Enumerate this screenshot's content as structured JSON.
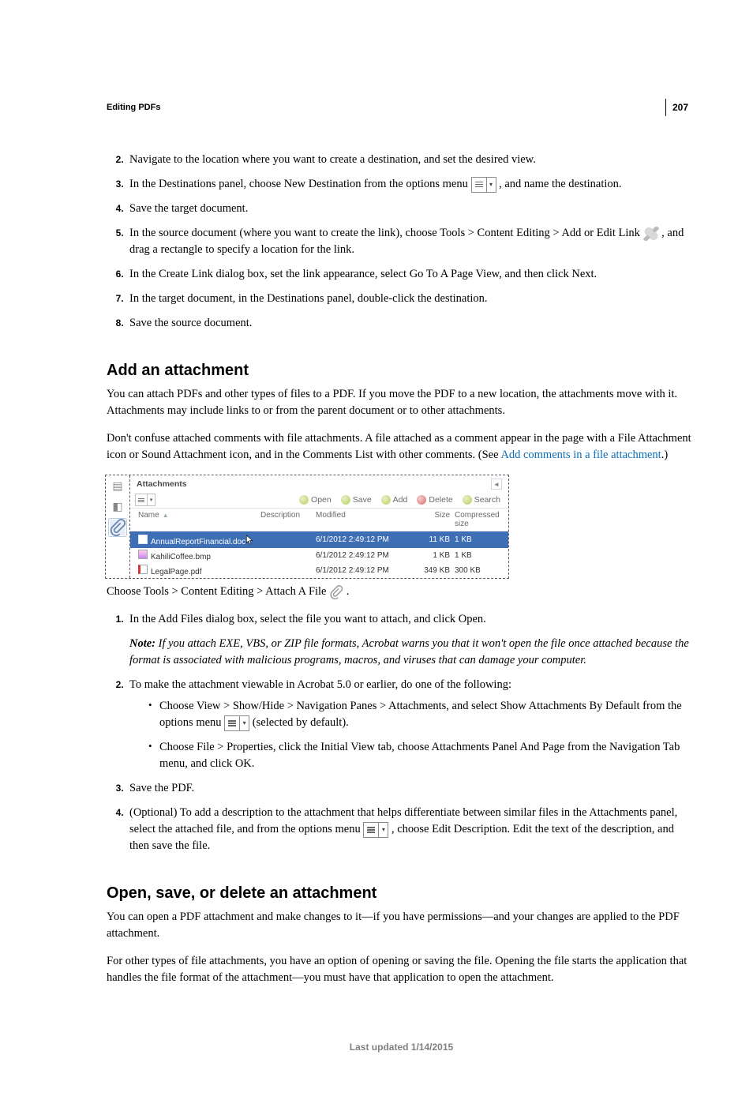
{
  "page_number": "207",
  "section_path": "Editing PDFs",
  "steps_a": {
    "s2": "Navigate to the location where you want to create a destination, and set the desired view.",
    "s3_before": "In the Destinations panel, choose New Destination from the options menu ",
    "s3_after": " , and name the destination.",
    "s4": "Save the target document.",
    "s5_before": "In the source document (where you want to create the link), choose Tools > Content Editing > Add or Edit Link ",
    "s5_after": " , and drag a rectangle to specify a location for the link.",
    "s6": "In the Create Link dialog box, set the link appearance, select Go To A Page View, and then click Next.",
    "s7": "In the target document, in the Destinations panel, double-click the destination.",
    "s8": "Save the source document."
  },
  "heading_attach": "Add an attachment",
  "para_attach_1": "You can attach PDFs and other types of files to a PDF. If you move the PDF to a new location, the attachments move with it. Attachments may include links to or from the parent document or to other attachments.",
  "para_attach_2_before": "Don't confuse attached comments with file attachments. A file attached as a comment appear in the page with a File Attachment icon or Sound Attachment icon, and in the Comments List with other comments. (See ",
  "para_attach_2_link": "Add comments in a file attachment",
  "para_attach_2_after": ".)",
  "screenshot": {
    "title": "Attachments",
    "toolbar": {
      "open": "Open",
      "save": "Save",
      "add": "Add",
      "delete": "Delete",
      "search": "Search"
    },
    "headers": {
      "name": "Name",
      "description": "Description",
      "modified": "Modified",
      "size": "Size",
      "compressed": "Compressed size"
    },
    "rows": [
      {
        "name": "AnnualReportFinancial.doc",
        "modified": "6/1/2012 2:49:12 PM",
        "size": "11 KB",
        "compressed": "1 KB"
      },
      {
        "name": "KahiliCoffee.bmp",
        "modified": "6/1/2012 2:49:12 PM",
        "size": "1 KB",
        "compressed": "1 KB"
      },
      {
        "name": "LegalPage.pdf",
        "modified": "6/1/2012 2:49:12 PM",
        "size": "349 KB",
        "compressed": "300 KB"
      }
    ]
  },
  "caption_attach_before": "Choose Tools > Content Editing > Attach A File ",
  "caption_attach_after": " .",
  "steps_b": {
    "s1": "In the Add Files dialog box, select the file you want to attach, and click Open.",
    "note_label": "Note: ",
    "note_text": "If you attach EXE, VBS, or ZIP file formats, Acrobat warns you that it won't open the file once attached because the format is associated with malicious programs, macros, and viruses that can damage your computer.",
    "s2": "To make the attachment viewable in Acrobat 5.0 or earlier, do one of the following:",
    "s2_bullets": {
      "b1_before": "Choose View > Show/Hide > Navigation Panes > Attachments, and select Show Attachments By Default from the options menu ",
      "b1_after": " (selected by default).",
      "b2": "Choose File > Properties, click the Initial View tab, choose Attachments Panel And Page from the Navigation Tab menu, and click OK."
    },
    "s3": "Save the PDF.",
    "s4_before": "(Optional) To add a description to the attachment that helps differentiate between similar files in the Attachments panel, select the attached file, and from the options menu ",
    "s4_after": " , choose Edit Description. Edit the text of the description, and then save the file."
  },
  "heading_open": "Open, save, or delete an attachment",
  "para_open_1": "You can open a PDF attachment and make changes to it—if you have permissions—and your changes are applied to the PDF attachment.",
  "para_open_2": "For other types of file attachments, you have an option of opening or saving the file. Opening the file starts the application that handles the file format of the attachment—you must have that application to open the attachment.",
  "footer": "Last updated 1/14/2015"
}
